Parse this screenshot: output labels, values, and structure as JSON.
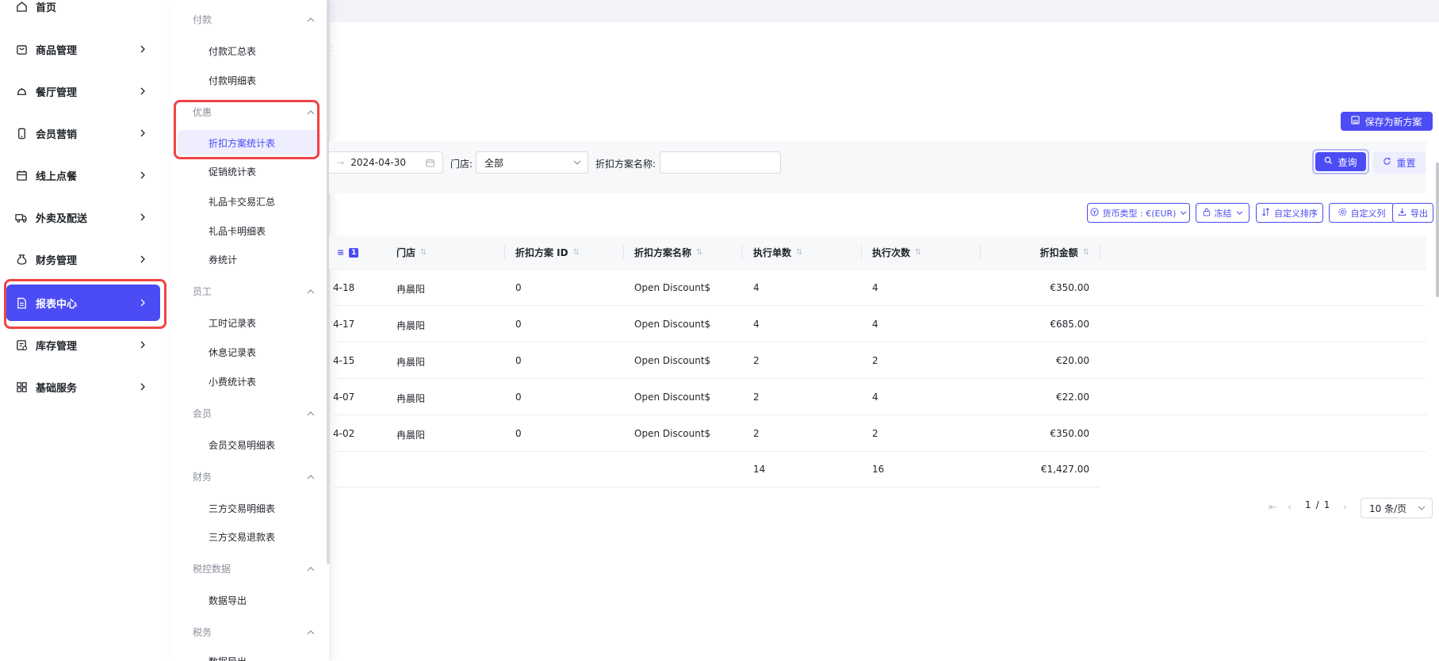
{
  "colors": {
    "accent": "#4c4cf5",
    "highlight": "#ef4444"
  },
  "nav": {
    "items": [
      {
        "label": "首页",
        "icon": "home-icon"
      },
      {
        "label": "商品管理",
        "icon": "bag-icon"
      },
      {
        "label": "餐厅管理",
        "icon": "cloche-icon"
      },
      {
        "label": "会员营销",
        "icon": "phone-icon"
      },
      {
        "label": "线上点餐",
        "icon": "calendar-icon"
      },
      {
        "label": "外卖及配送",
        "icon": "truck-icon"
      },
      {
        "label": "财务管理",
        "icon": "moneybag-icon"
      },
      {
        "label": "报表中心",
        "icon": "report-icon"
      },
      {
        "label": "库存管理",
        "icon": "inventory-icon"
      },
      {
        "label": "基础服务",
        "icon": "grid-icon"
      }
    ],
    "active": "报表中心"
  },
  "submenu": {
    "groups": [
      {
        "label": "付款",
        "items": [
          "付款汇总表",
          "付款明细表"
        ]
      },
      {
        "label": "优惠",
        "items": [
          "折扣方案统计表",
          "促销统计表",
          "礼品卡交易汇总",
          "礼品卡明细表",
          "券统计"
        ]
      },
      {
        "label": "员工",
        "items": [
          "工时记录表",
          "休息记录表",
          "小费统计表"
        ]
      },
      {
        "label": "会员",
        "items": [
          "会员交易明细表"
        ]
      },
      {
        "label": "财务",
        "items": [
          "三方交易明细表",
          "三方交易退款表"
        ]
      },
      {
        "label": "税控数据",
        "items": [
          "数据导出"
        ]
      },
      {
        "label": "税务",
        "items": [
          "数据导出"
        ]
      }
    ],
    "active": "折扣方案统计表"
  },
  "toolbar": {
    "save_new_plan": "保存为新方案"
  },
  "filters": {
    "faint_colon": ":",
    "date_end": "2024-04-30",
    "store_label": "门店:",
    "store_value": "全部",
    "plan_name_label": "折扣方案名称:",
    "plan_name_value": "",
    "query": "查询",
    "reset": "重置"
  },
  "table_tools": {
    "currency": "货币类型 : €(EUR)",
    "freeze": "冻结",
    "custom_sort": "自定义排序",
    "custom_columns": "自定义列",
    "export": "导出"
  },
  "table": {
    "sort_badge": "1",
    "columns": [
      "门店",
      "折扣方案 ID",
      "折扣方案名称",
      "执行单数",
      "执行次数",
      "折扣金额"
    ],
    "rows": [
      {
        "date": "4-18",
        "store": "冉晨阳",
        "plan_id": "0",
        "plan_name": "Open Discount$",
        "orders": "4",
        "times": "4",
        "amount": "€350.00"
      },
      {
        "date": "4-17",
        "store": "冉晨阳",
        "plan_id": "0",
        "plan_name": "Open Discount$",
        "orders": "4",
        "times": "4",
        "amount": "€685.00"
      },
      {
        "date": "4-15",
        "store": "冉晨阳",
        "plan_id": "0",
        "plan_name": "Open Discount$",
        "orders": "2",
        "times": "2",
        "amount": "€20.00"
      },
      {
        "date": "4-07",
        "store": "冉晨阳",
        "plan_id": "0",
        "plan_name": "Open Discount$",
        "orders": "2",
        "times": "4",
        "amount": "€22.00"
      },
      {
        "date": "4-02",
        "store": "冉晨阳",
        "plan_id": "0",
        "plan_name": "Open Discount$",
        "orders": "2",
        "times": "2",
        "amount": "€350.00"
      }
    ],
    "totals": {
      "orders": "14",
      "times": "16",
      "amount": "€1,427.00"
    }
  },
  "pagination": {
    "page": "1",
    "sep": "/",
    "total": "1",
    "page_size": "10 条/页"
  }
}
